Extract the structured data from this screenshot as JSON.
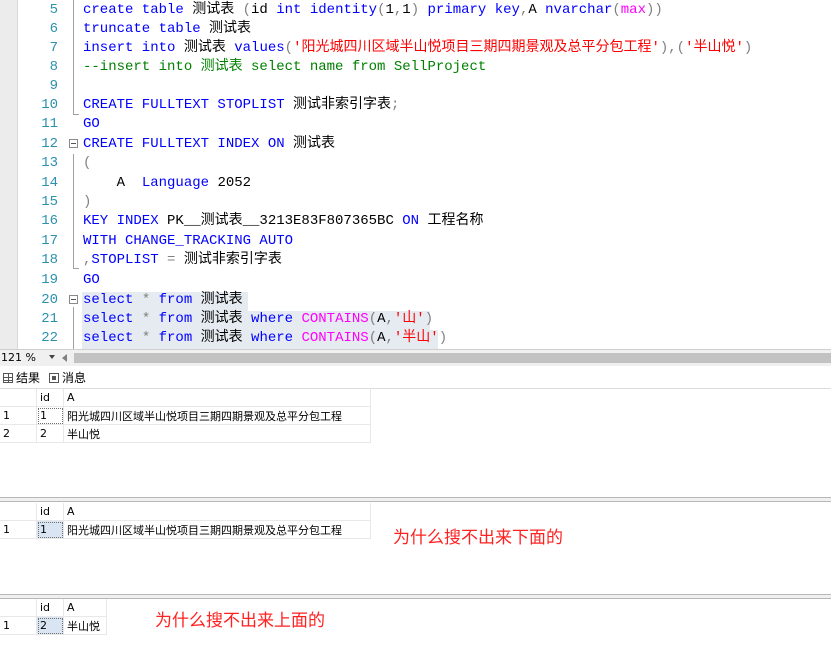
{
  "editor": {
    "lines": [
      {
        "num": "5",
        "parts": [
          {
            "t": "create table ",
            "c": "kw"
          },
          {
            "t": "测试表 ",
            "c": ""
          },
          {
            "t": "(",
            "c": "gr"
          },
          {
            "t": "id ",
            "c": ""
          },
          {
            "t": "int ",
            "c": "kw"
          },
          {
            "t": "identity",
            "c": "kw"
          },
          {
            "t": "(",
            "c": "gr"
          },
          {
            "t": "1",
            "c": ""
          },
          {
            "t": ",",
            "c": "gr"
          },
          {
            "t": "1",
            "c": ""
          },
          {
            "t": ") ",
            "c": "gr"
          },
          {
            "t": "primary key",
            "c": "kw"
          },
          {
            "t": ",",
            "c": "gr"
          },
          {
            "t": "A ",
            "c": ""
          },
          {
            "t": "nvarchar",
            "c": "kw"
          },
          {
            "t": "(",
            "c": "gr"
          },
          {
            "t": "max",
            "c": "fn"
          },
          {
            "t": "))",
            "c": "gr"
          }
        ]
      },
      {
        "num": "6",
        "parts": [
          {
            "t": "truncate table ",
            "c": "kw"
          },
          {
            "t": "测试表",
            "c": ""
          }
        ]
      },
      {
        "num": "7",
        "parts": [
          {
            "t": "insert into ",
            "c": "kw"
          },
          {
            "t": "测试表 ",
            "c": ""
          },
          {
            "t": "values",
            "c": "kw"
          },
          {
            "t": "(",
            "c": "gr"
          },
          {
            "t": "'阳光城四川区域半山悦项目三期四期景观及总平分包工程'",
            "c": "str"
          },
          {
            "t": "),(",
            "c": "gr"
          },
          {
            "t": "'半山悦'",
            "c": "str"
          },
          {
            "t": ")",
            "c": "gr"
          }
        ]
      },
      {
        "num": "8",
        "parts": [
          {
            "t": "--insert into 测试表 select name from SellProject",
            "c": "cm"
          }
        ]
      },
      {
        "num": "9",
        "parts": []
      },
      {
        "num": "10",
        "parts": [
          {
            "t": "CREATE FULLTEXT STOPLIST ",
            "c": "kw"
          },
          {
            "t": "测试非索引字表",
            "c": ""
          },
          {
            "t": ";",
            "c": "gr"
          }
        ]
      },
      {
        "num": "11",
        "parts": [
          {
            "t": "GO",
            "c": "kw"
          }
        ]
      },
      {
        "num": "12",
        "parts": [
          {
            "t": "CREATE FULLTEXT INDEX ON ",
            "c": "kw"
          },
          {
            "t": "测试表",
            "c": ""
          }
        ]
      },
      {
        "num": "13",
        "parts": [
          {
            "t": "(",
            "c": "gr"
          }
        ]
      },
      {
        "num": "14",
        "parts": [
          {
            "t": "    A  ",
            "c": ""
          },
          {
            "t": "Language ",
            "c": "kw"
          },
          {
            "t": "2052",
            "c": ""
          }
        ]
      },
      {
        "num": "15",
        "parts": [
          {
            "t": ")",
            "c": "gr"
          }
        ]
      },
      {
        "num": "16",
        "parts": [
          {
            "t": "KEY INDEX ",
            "c": "kw"
          },
          {
            "t": "PK__测试表__3213E83F807365BC ",
            "c": ""
          },
          {
            "t": "ON ",
            "c": "kw"
          },
          {
            "t": "工程名称",
            "c": ""
          }
        ]
      },
      {
        "num": "17",
        "parts": [
          {
            "t": "WITH CHANGE_TRACKING AUTO",
            "c": "kw"
          }
        ]
      },
      {
        "num": "18",
        "parts": [
          {
            "t": ",",
            "c": "gr"
          },
          {
            "t": "STOPLIST ",
            "c": "kw"
          },
          {
            "t": "= ",
            "c": "gr"
          },
          {
            "t": "测试非索引字表",
            "c": ""
          }
        ]
      },
      {
        "num": "19",
        "parts": [
          {
            "t": "GO",
            "c": "kw"
          }
        ]
      },
      {
        "num": "20",
        "parts": [
          {
            "t": "select ",
            "c": "kw"
          },
          {
            "t": "* ",
            "c": "gr"
          },
          {
            "t": "from ",
            "c": "kw"
          },
          {
            "t": "测试表",
            "c": ""
          }
        ]
      },
      {
        "num": "21",
        "parts": [
          {
            "t": "select ",
            "c": "kw"
          },
          {
            "t": "* ",
            "c": "gr"
          },
          {
            "t": "from ",
            "c": "kw"
          },
          {
            "t": "测试表 ",
            "c": ""
          },
          {
            "t": "where ",
            "c": "kw"
          },
          {
            "t": "CONTAINS",
            "c": "fn"
          },
          {
            "t": "(",
            "c": "gr"
          },
          {
            "t": "A",
            "c": ""
          },
          {
            "t": ",",
            "c": "gr"
          },
          {
            "t": "'山'",
            "c": "str"
          },
          {
            "t": ")",
            "c": "gr"
          }
        ]
      },
      {
        "num": "22",
        "parts": [
          {
            "t": "select ",
            "c": "kw"
          },
          {
            "t": "* ",
            "c": "gr"
          },
          {
            "t": "from ",
            "c": "kw"
          },
          {
            "t": "测试表 ",
            "c": ""
          },
          {
            "t": "where ",
            "c": "kw"
          },
          {
            "t": "CONTAINS",
            "c": "fn"
          },
          {
            "t": "(",
            "c": "gr"
          },
          {
            "t": "A",
            "c": ""
          },
          {
            "t": ",",
            "c": "gr"
          },
          {
            "t": "'半山'",
            "c": "str"
          },
          {
            "t": ")",
            "c": "gr"
          }
        ]
      }
    ]
  },
  "status": {
    "zoom": "121 %"
  },
  "tabs": [
    {
      "label": "结果",
      "icon": "grid-icon"
    },
    {
      "label": "消息",
      "icon": "messages-icon"
    }
  ],
  "results": [
    {
      "headers": [
        "id",
        "A"
      ],
      "rows": [
        {
          "rownum": "1",
          "id": "1",
          "A": "阳光城四川区域半山悦项目三期四期景观及总平分包工程"
        },
        {
          "rownum": "2",
          "id": "2",
          "A": "半山悦"
        }
      ],
      "annotation": ""
    },
    {
      "headers": [
        "id",
        "A"
      ],
      "rows": [
        {
          "rownum": "1",
          "id": "1",
          "A": "阳光城四川区域半山悦项目三期四期景观及总平分包工程"
        }
      ],
      "annotation": "为什么搜不出来下面的"
    },
    {
      "headers": [
        "id",
        "A"
      ],
      "rows": [
        {
          "rownum": "1",
          "id": "2",
          "A": "半山悦"
        }
      ],
      "annotation": "为什么搜不出来上面的"
    }
  ],
  "colors": {
    "keyword": "#0000ff",
    "string": "#ff0000",
    "function": "#ff00ff",
    "comment": "#008000",
    "lineNumber": "#2b91af",
    "annotation": "#ff2020"
  }
}
